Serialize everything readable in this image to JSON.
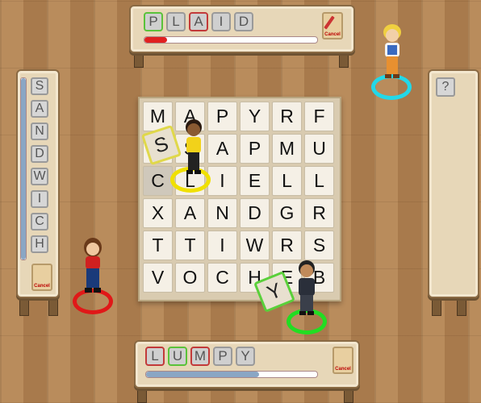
{
  "top_desk": {
    "word_tiles": [
      {
        "letter": "P",
        "color": "green"
      },
      {
        "letter": "L",
        "color": "none"
      },
      {
        "letter": "A",
        "color": "red"
      },
      {
        "letter": "I",
        "color": "none"
      },
      {
        "letter": "D",
        "color": "none"
      }
    ],
    "cancel_label": "Cancel",
    "progress_fraction": 0.13,
    "progress_color": "#e02020"
  },
  "bottom_desk": {
    "word_tiles": [
      {
        "letter": "L",
        "color": "red"
      },
      {
        "letter": "U",
        "color": "green"
      },
      {
        "letter": "M",
        "color": "red"
      },
      {
        "letter": "P",
        "color": "none"
      },
      {
        "letter": "Y",
        "color": "none"
      }
    ],
    "cancel_label": "Cancel",
    "progress_fraction": 0.66,
    "progress_color": "#8aa6c4"
  },
  "left_desk": {
    "word_tiles": [
      "S",
      "A",
      "N",
      "D",
      "W",
      "I",
      "C",
      "H"
    ],
    "cancel_label": "Cancel",
    "progress_fraction": 1.0,
    "progress_color": "#8aa6c4"
  },
  "right_desk": {
    "hidden_tile": "?"
  },
  "board": {
    "rows": [
      [
        "M",
        "A",
        "P",
        "Y",
        "R",
        "F"
      ],
      [
        "",
        "S",
        "A",
        "P",
        "M",
        "U"
      ],
      [
        "C",
        "L",
        "I",
        "E",
        "L",
        "L"
      ],
      [
        "X",
        "A",
        "N",
        "D",
        "G",
        "R"
      ],
      [
        "T",
        "T",
        "I",
        "W",
        "R",
        "S"
      ],
      [
        "V",
        "O",
        "C",
        "H",
        "E",
        "B"
      ]
    ],
    "empty_cell": "",
    "dimmed_cells": [
      [
        2,
        0
      ]
    ]
  },
  "held_tiles": {
    "yellow_player": "S",
    "green_player": "Y"
  },
  "player_colors": {
    "yellow": "#f0e000",
    "green": "#22dd22",
    "red": "#e01818",
    "cyan": "#22d8e8"
  }
}
